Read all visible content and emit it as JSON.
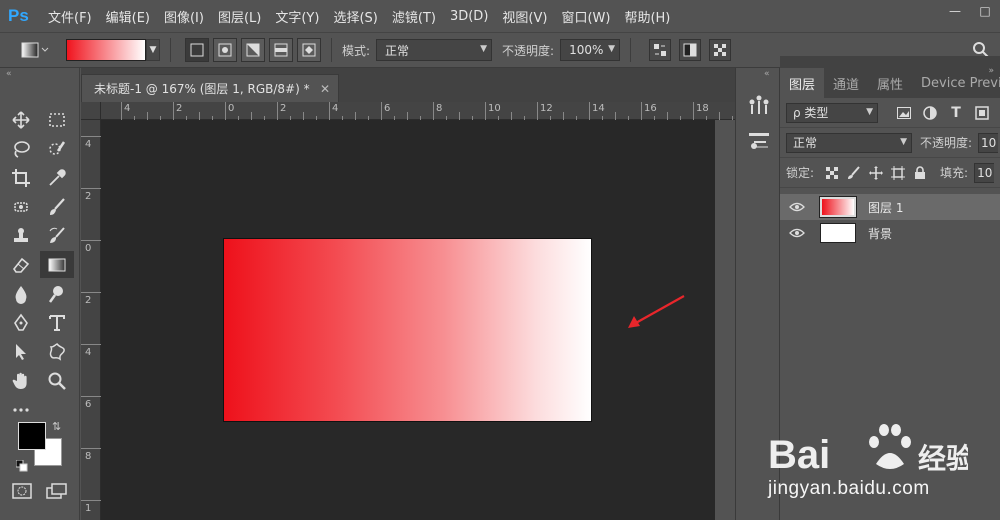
{
  "app": {
    "logo": "Ps",
    "menu": [
      "文件(F)",
      "编辑(E)",
      "图像(I)",
      "图层(L)",
      "文字(Y)",
      "选择(S)",
      "滤镜(T)",
      "3D(D)",
      "视图(V)",
      "窗口(W)",
      "帮助(H)"
    ]
  },
  "options": {
    "mode_label": "模式:",
    "mode_value": "正常",
    "opacity_label": "不透明度:",
    "opacity_value": "100%",
    "gradient_start_color": "#f0141e",
    "gradient_end_color": "#ffffff"
  },
  "document": {
    "tab_title": "未标题-1 @ 167% (图层 1, RGB/8#) *",
    "ruler_top": [
      "4",
      "2",
      "0",
      "2",
      "4",
      "6",
      "8",
      "10",
      "12",
      "14",
      "16",
      "18"
    ],
    "ruler_left": [
      "4",
      "2",
      "0",
      "2",
      "4",
      "6",
      "8",
      "1"
    ]
  },
  "panel": {
    "tabs": [
      "图层",
      "通道",
      "属性",
      "Device Preview"
    ],
    "filter_label": "ρ 类型",
    "blend_mode": "正常",
    "opacity_label": "不透明度:",
    "opacity_value": "10",
    "lock_label": "锁定:",
    "fill_label": "填充:",
    "fill_value": "10",
    "layers": [
      {
        "name": "图层 1",
        "selected": true
      },
      {
        "name": "背景",
        "selected": false
      }
    ]
  },
  "watermark": {
    "text": "jingyan.baidu.com"
  }
}
